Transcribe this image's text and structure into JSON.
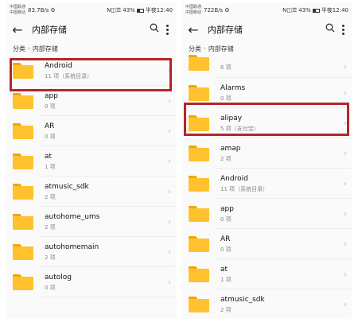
{
  "status_left": {
    "carrier1": "中国联通",
    "carrier2": "中国移动",
    "speed": "83.7B/s",
    "extras": "⚙"
  },
  "status_right": {
    "carrier1": "中国联通",
    "carrier2": "中国移动",
    "speed": "722B/s",
    "extras": "⚙"
  },
  "status": {
    "signal": "N◫☰",
    "battery": "43%",
    "time": "半夜12:40"
  },
  "appbar": {
    "back": "←",
    "title": "内部存储",
    "search": "🔍"
  },
  "breadcrumb": {
    "root": "分类",
    "sep": "›",
    "current": "内部存储"
  },
  "chevron": "›",
  "left_items": [
    {
      "name": "Android",
      "sub": "11 项（系统目录）"
    },
    {
      "name": "app",
      "sub": "0 项"
    },
    {
      "name": "AR",
      "sub": "0 项"
    },
    {
      "name": "at",
      "sub": "1 项"
    },
    {
      "name": "atmusic_sdk",
      "sub": "2 项"
    },
    {
      "name": "autohome_ums",
      "sub": "2 项"
    },
    {
      "name": "autohomemain",
      "sub": "2 项"
    },
    {
      "name": "autolog",
      "sub": "0 项"
    }
  ],
  "right_partial": {
    "sub": "6 项"
  },
  "right_items": [
    {
      "name": "Alarms",
      "sub": "0 项"
    },
    {
      "name": "alipay",
      "sub": "5 项（支付宝）"
    },
    {
      "name": "amap",
      "sub": "2 项"
    },
    {
      "name": "Android",
      "sub": "11 项（系统目录）"
    },
    {
      "name": "app",
      "sub": "0 项"
    },
    {
      "name": "AR",
      "sub": "0 项"
    },
    {
      "name": "at",
      "sub": "1 项"
    },
    {
      "name": "atmusic_sdk",
      "sub": "2 项"
    }
  ],
  "highlight_color": "#b3262b",
  "folder_color": "#ffc22e"
}
